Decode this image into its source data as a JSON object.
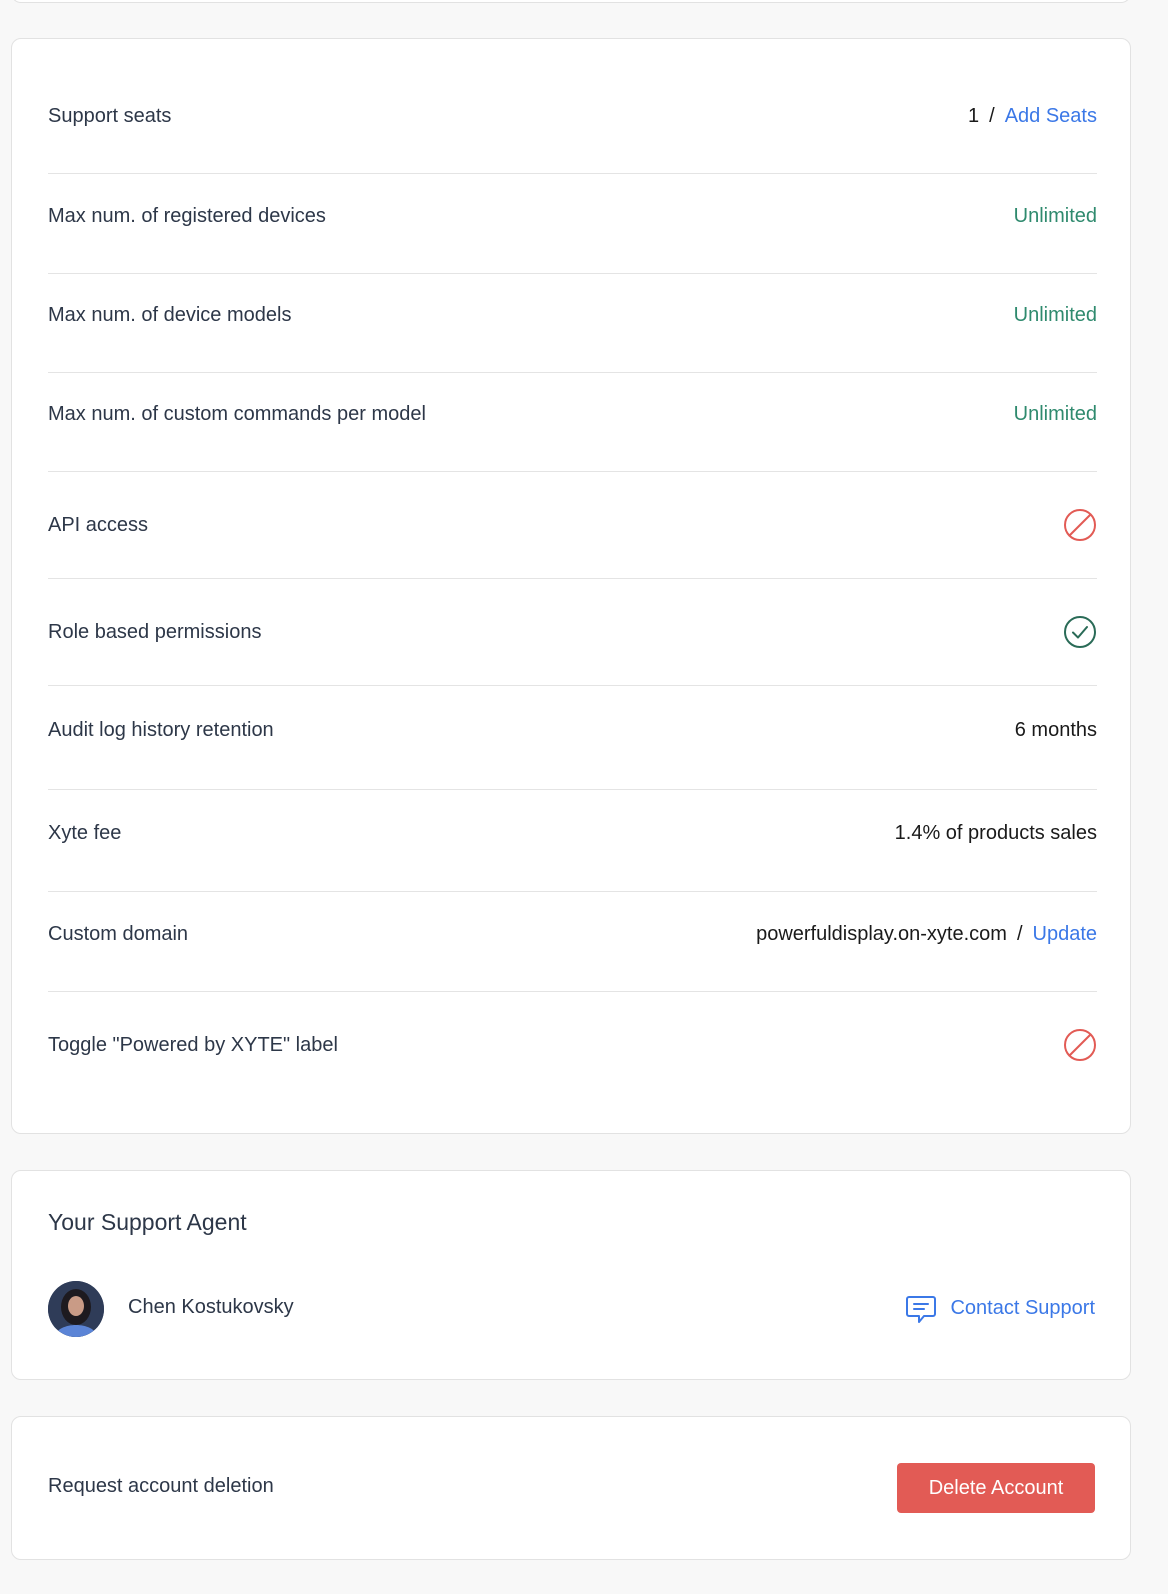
{
  "plan": {
    "rows": [
      {
        "label": "Support seats",
        "value": "1",
        "sep": "/",
        "link": "Add Seats"
      },
      {
        "label": "Max num. of registered devices",
        "value": "Unlimited"
      },
      {
        "label": "Max num. of device models",
        "value": "Unlimited"
      },
      {
        "label": "Max num. of custom commands per model",
        "value": "Unlimited"
      },
      {
        "label": "API access",
        "icon": "not-allowed-icon"
      },
      {
        "label": "Role based permissions",
        "icon": "check-circle-icon"
      },
      {
        "label": "Audit log history retention",
        "value": "6 months"
      },
      {
        "label": "Xyte fee",
        "value": "1.4% of products sales"
      },
      {
        "label": "Custom domain",
        "value": "powerfuldisplay.on-xyte.com",
        "sep": "/",
        "link": "Update"
      },
      {
        "label": "Toggle \"Powered by XYTE\" label",
        "icon": "not-allowed-icon"
      }
    ]
  },
  "agent": {
    "title": "Your Support Agent",
    "name": "Chen Kostukovsky",
    "contact_label": "Contact Support",
    "contact_icon": "chat-bubble-icon"
  },
  "deletion": {
    "label": "Request account deletion",
    "button_label": "Delete Account"
  },
  "colors": {
    "accent": "#3b78e7",
    "success": "#2f8a6e",
    "danger": "#e25b55"
  }
}
